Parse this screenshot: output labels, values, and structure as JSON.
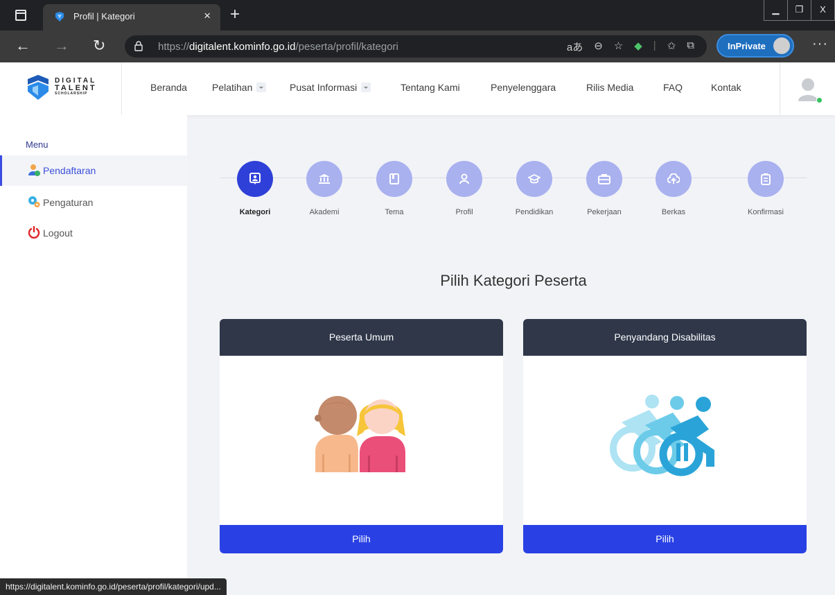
{
  "browser": {
    "tab_title": "Profil | Kategori",
    "tab_close": "×",
    "new_tab": "+",
    "win_min": "▁",
    "win_restore": "❐",
    "win_close": "X",
    "url_scheme": "https://",
    "url_host": "digitalent.kominfo.go.id",
    "url_path": "/peserta/profil/kategori",
    "read_aloud": "aあ",
    "inprivate_label": "InPrivate",
    "more": "···"
  },
  "site": {
    "logo": {
      "line1": "DIGITAL",
      "line2": "TALENT",
      "line3": "SCHOLARSHIP"
    },
    "nav": {
      "beranda": "Beranda",
      "pelatihan": "Pelatihan",
      "pusat_informasi": "Pusat Informasi",
      "tentang_kami": "Tentang Kami",
      "penyelenggara": "Penyelenggara",
      "rilis_media": "Rilis Media",
      "faq": "FAQ",
      "kontak": "Kontak"
    }
  },
  "sidebar": {
    "menu_label": "Menu",
    "items": [
      {
        "label": "Pendaftaran",
        "icon": "user-check-icon",
        "active": true
      },
      {
        "label": "Pengaturan",
        "icon": "gears-icon",
        "active": false
      },
      {
        "label": "Logout",
        "icon": "power-icon",
        "active": false
      }
    ]
  },
  "stepper": {
    "steps": [
      {
        "label": "Kategori",
        "icon": "badge-icon",
        "active": true
      },
      {
        "label": "Akademi",
        "icon": "institution-icon",
        "active": false
      },
      {
        "label": "Tema",
        "icon": "book-icon",
        "active": false
      },
      {
        "label": "Profil",
        "icon": "person-icon",
        "active": false
      },
      {
        "label": "Pendidikan",
        "icon": "graduation-cap-icon",
        "active": false
      },
      {
        "label": "Pekerjaan",
        "icon": "briefcase-icon",
        "active": false
      },
      {
        "label": "Berkas",
        "icon": "cloud-upload-icon",
        "active": false
      },
      {
        "label": "Konfirmasi",
        "icon": "clipboard-icon",
        "active": false
      }
    ]
  },
  "main": {
    "title": "Pilih Kategori Peserta",
    "cards": [
      {
        "title": "Peserta Umum",
        "button": "Pilih",
        "illustration": "two-people-illustration"
      },
      {
        "title": "Penyandang Disabilitas",
        "button": "Pilih",
        "illustration": "wheelchair-illustration"
      }
    ]
  },
  "status_url": "https://digitalent.kominfo.go.id/peserta/profil/kategori/upd...",
  "colors": {
    "primary": "#2941e4",
    "step_active": "#2e40d7",
    "step_inactive": "#a9b1ef",
    "card_header": "#2f3749"
  }
}
